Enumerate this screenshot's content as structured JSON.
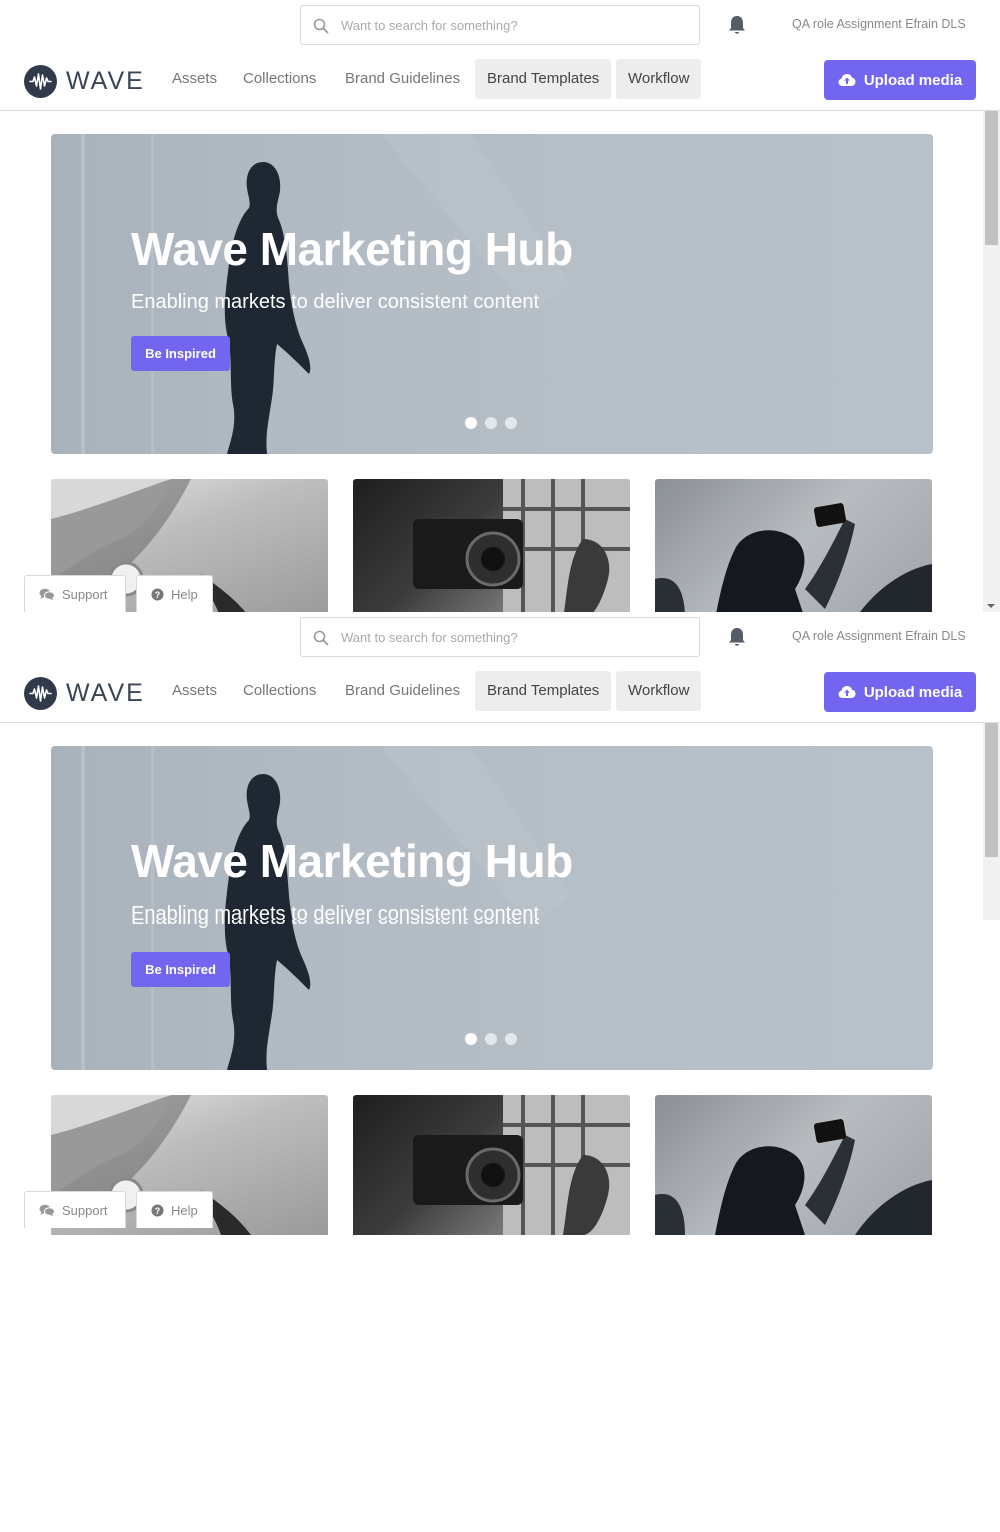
{
  "header": {
    "search_placeholder": "Want to search for something?",
    "user_name": "QA role Assignment Efrain DLS",
    "icons": {
      "search": "search-icon",
      "bell": "bell-icon"
    }
  },
  "nav": {
    "logo_text": "WAVE",
    "items": [
      {
        "label": "Assets",
        "active": false
      },
      {
        "label": "Collections",
        "active": false
      },
      {
        "label": "Brand Guidelines",
        "active": false
      },
      {
        "label": "Brand Templates",
        "active": true
      },
      {
        "label": "Workflow",
        "active": true
      }
    ],
    "upload_label": "Upload media"
  },
  "hero": {
    "title": "Wave Marketing Hub",
    "subtitle": "Enabling markets to deliver consistent content",
    "button_label": "Be Inspired",
    "slides": 3,
    "active_slide": 1
  },
  "floating": {
    "support_label": "Support",
    "help_label": "Help"
  },
  "colors": {
    "accent": "#7266f0",
    "hero_bg": "#b2bbc3"
  }
}
